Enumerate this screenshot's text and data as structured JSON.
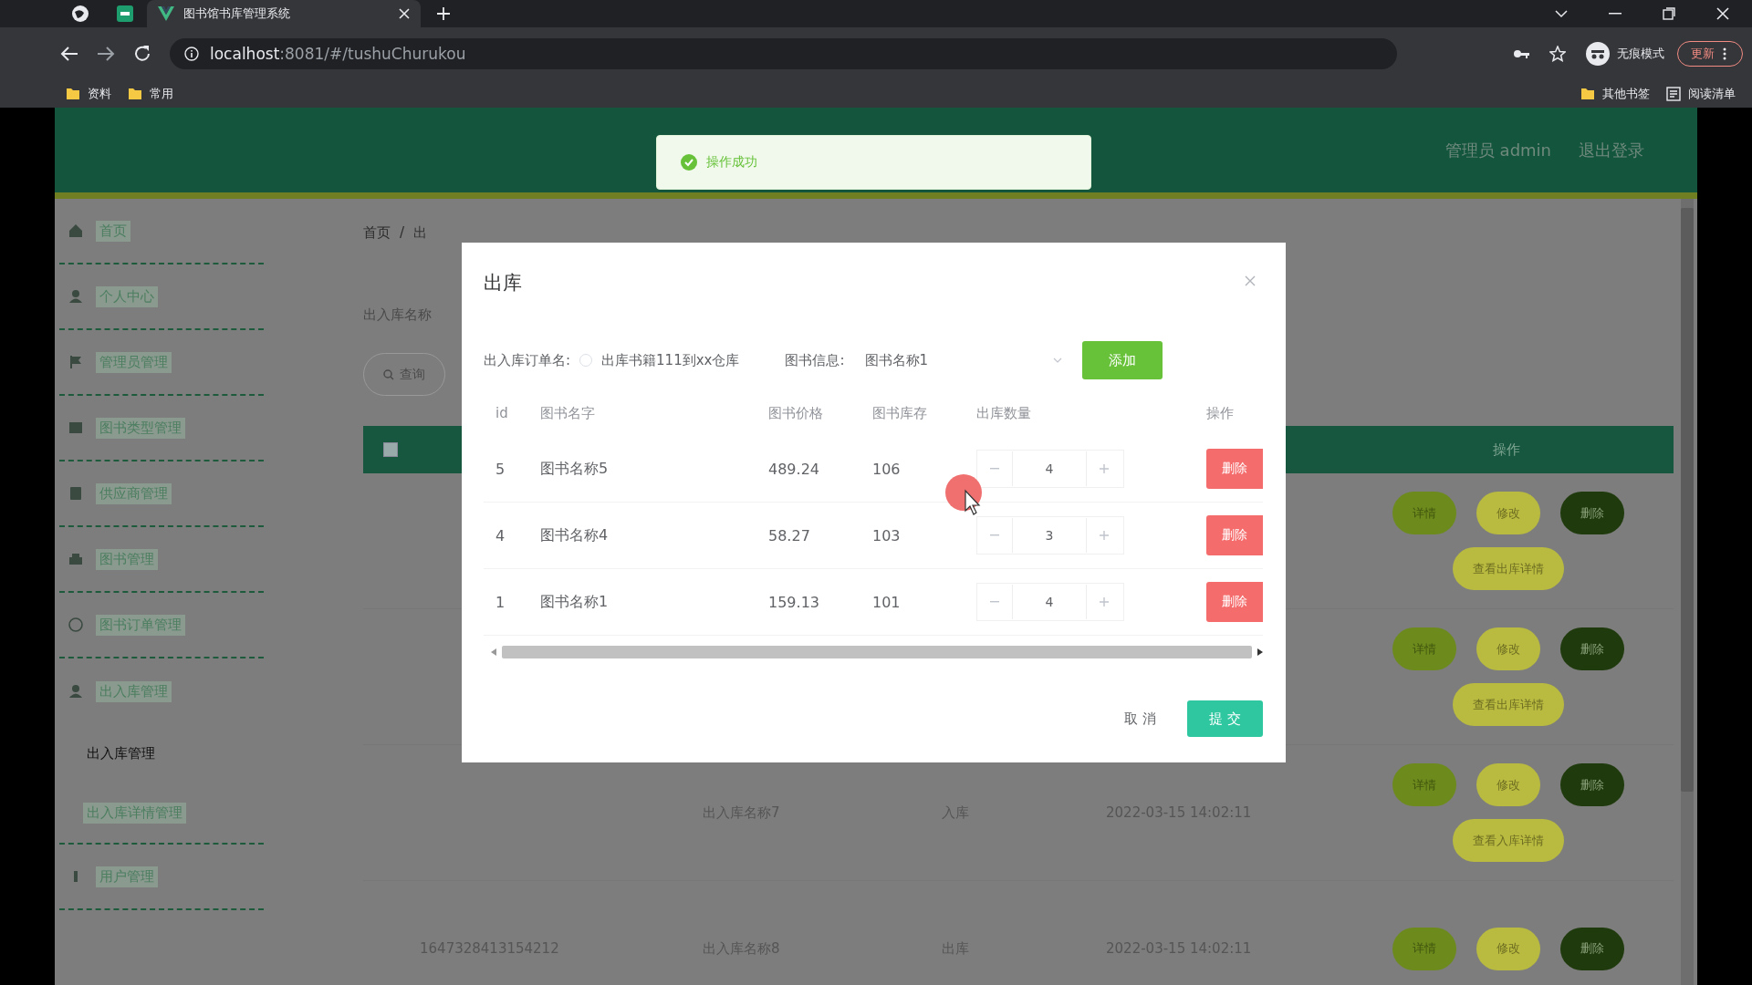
{
  "browser": {
    "tabs": [
      {
        "title": "图书馆书库管理系统",
        "selected": true
      }
    ],
    "url_host": "localhost",
    "url_path": ":8081/#/tushuChurukou",
    "profile": "无痕模式",
    "update_button": "更新",
    "bookmarks": [
      "资料",
      "常用"
    ],
    "bookmarks_right": [
      "其他书签",
      "阅读清单"
    ]
  },
  "header": {
    "user": "管理员 admin",
    "logout": "退出登录"
  },
  "toast": {
    "text": "操作成功"
  },
  "sidebar": {
    "items": [
      {
        "label": "首页",
        "expanded": false
      },
      {
        "label": "个人中心",
        "expanded": false
      },
      {
        "label": "管理员管理",
        "expanded": false
      },
      {
        "label": "图书类型管理",
        "expanded": false
      },
      {
        "label": "供应商管理",
        "expanded": false
      },
      {
        "label": "图书管理",
        "expanded": false
      },
      {
        "label": "图书订单管理",
        "expanded": false
      },
      {
        "label": "出入库管理",
        "expanded": true,
        "children": [
          {
            "label": "出入库管理",
            "selected": true
          },
          {
            "label": "出入库详情管理",
            "selected": false
          }
        ]
      },
      {
        "label": "用户管理",
        "expanded": false
      }
    ]
  },
  "breadcrumb": [
    "首页",
    "出"
  ],
  "breadcrumb_separator": "/",
  "select_all": {
    "checked": false
  },
  "search": {
    "label": "出入库名称",
    "button": "查询"
  },
  "table": {
    "columns": [
      "操作"
    ],
    "rows": [
      {
        "actions": [
          {
            "label": "详情",
            "kind": "detail"
          },
          {
            "label": "修改",
            "kind": "edit"
          },
          {
            "label": "删除",
            "kind": "delete"
          },
          {
            "label": "查看出库详情",
            "kind": "view"
          }
        ]
      },
      {
        "actions": [
          {
            "label": "详情",
            "kind": "detail"
          },
          {
            "label": "修改",
            "kind": "edit"
          },
          {
            "label": "删除",
            "kind": "delete"
          },
          {
            "label": "查看出库详情",
            "kind": "view"
          }
        ]
      },
      {
        "column_3": "出入库名称7",
        "column_4": "入库",
        "column_5": "2022-03-15 14:02:11",
        "actions": [
          {
            "label": "详情",
            "kind": "detail"
          },
          {
            "label": "修改",
            "kind": "edit"
          },
          {
            "label": "删除",
            "kind": "delete"
          },
          {
            "label": "查看入库详情",
            "kind": "view"
          }
        ]
      },
      {
        "column_2": "1647328413154212",
        "column_3": "出入库名称8",
        "column_4": "出库",
        "column_5": "2022-03-15 14:02:11",
        "actions": [
          {
            "label": "详情",
            "kind": "detail"
          },
          {
            "label": "修改",
            "kind": "edit"
          },
          {
            "label": "删除",
            "kind": "delete"
          }
        ]
      }
    ]
  },
  "dialog": {
    "title": "出库",
    "order_label": "出入库订单名:",
    "order_radio_checked": false,
    "order_value": "出库书籍111到xx仓库",
    "book_label": "图书信息:",
    "book_value": "图书名称1",
    "add_button": "添加",
    "columns": [
      "id",
      "图书名字",
      "图书价格",
      "图书库存",
      "出库数量",
      "操作"
    ],
    "rows": [
      {
        "id": "5",
        "name": "图书名称5",
        "price": "489.24",
        "stock": "106",
        "quantity": "4",
        "action": "删除"
      },
      {
        "id": "4",
        "name": "图书名称4",
        "price": "58.27",
        "stock": "103",
        "quantity": "3",
        "action": "删除"
      },
      {
        "id": "1",
        "name": "图书名称1",
        "price": "159.13",
        "stock": "101",
        "quantity": "4",
        "action": "删除"
      }
    ],
    "buttons": [
      {
        "label": "取 消",
        "kind": "cancel"
      },
      {
        "label": "提 交",
        "kind": "primary"
      }
    ]
  }
}
